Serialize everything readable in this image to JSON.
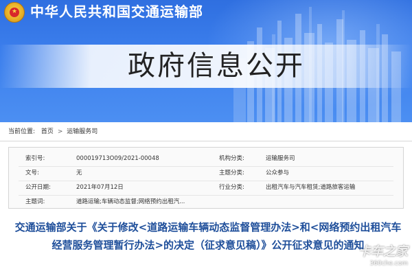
{
  "header": {
    "ministry_name": "中华人民共和国交通运输部",
    "section_title": "政府信息公开"
  },
  "breadcrumb": {
    "prefix": "当前位置:",
    "items": [
      "首页",
      "运输服务司"
    ],
    "separator": ">"
  },
  "info": {
    "rows": [
      {
        "label1": "索引号:",
        "value1": "000019713O09/2021-00048",
        "label2": "机构分类:",
        "value2": "运输服务司"
      },
      {
        "label1": "文号:",
        "value1": "无",
        "label2": "主题分类:",
        "value2": "公众参与"
      },
      {
        "label1": "公开日期:",
        "value1": "2021年07月12日",
        "label2": "行业分类:",
        "value2": "出租汽车与汽车租赁;道路旅客运输"
      },
      {
        "label1": "主题词:",
        "value1": "道路运输;车辆动态监督;网络预约出租汽...",
        "label2": "",
        "value2": ""
      }
    ]
  },
  "document": {
    "headline": "交通运输部关于《关于修改<道路运输车辆动态监督管理办法>和<网络预约出租汽车经营服务管理暂行办法>的决定（征求意见稿）》公开征求意见的通知"
  },
  "watermark": {
    "main": "卡车之家",
    "sub": "360che.com"
  },
  "colors": {
    "banner_blue": "#3b7eec",
    "headline_blue": "#1e4e9a",
    "emblem_red": "#d8282a",
    "emblem_gold": "#f7d24a"
  }
}
